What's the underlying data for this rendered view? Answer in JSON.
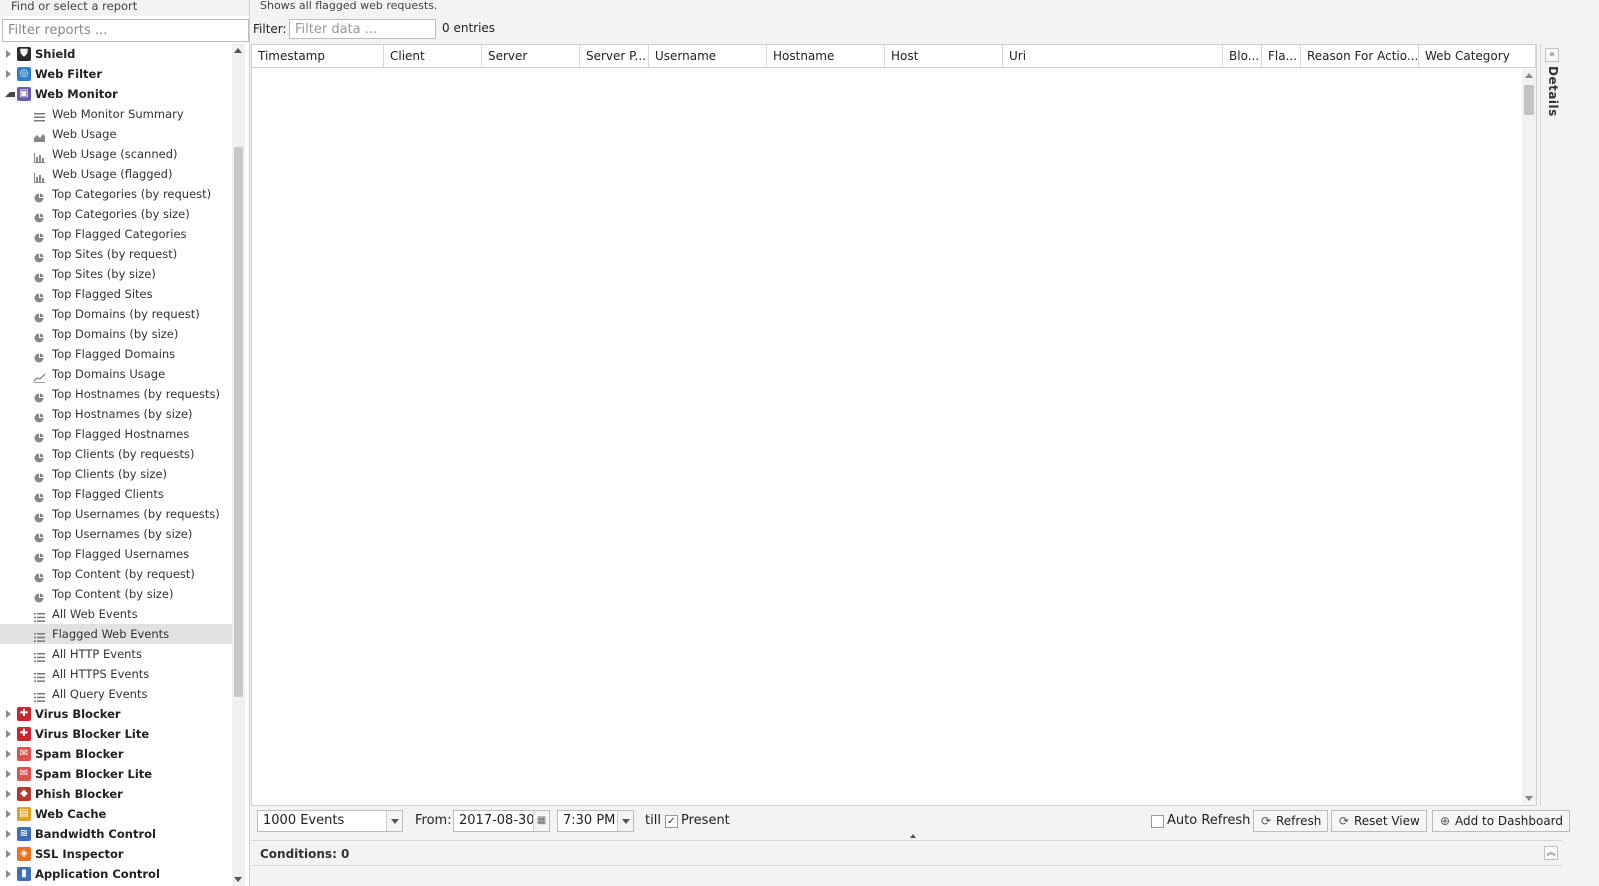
{
  "left": {
    "header": "Find or select a report",
    "filter_placeholder": "Filter reports ...",
    "tree": [
      {
        "label": "Shield",
        "level": "top",
        "expanded": false,
        "icon": "shield-icon",
        "color": "#2b2b2b"
      },
      {
        "label": "Web Filter",
        "level": "top",
        "expanded": false,
        "icon": "web-filter-icon",
        "color": "#2f7fc8"
      },
      {
        "label": "Web Monitor",
        "level": "top",
        "expanded": true,
        "icon": "web-monitor-icon",
        "color": "#6b5bb0"
      },
      {
        "label": "Web Monitor Summary",
        "level": "child",
        "icon": "summary-icon"
      },
      {
        "label": "Web Usage",
        "level": "child",
        "icon": "area-chart-icon"
      },
      {
        "label": "Web Usage (scanned)",
        "level": "child",
        "icon": "bar-chart-icon"
      },
      {
        "label": "Web Usage (flagged)",
        "level": "child",
        "icon": "bar-chart-icon"
      },
      {
        "label": "Top Categories (by request)",
        "level": "child",
        "icon": "pie-chart-icon"
      },
      {
        "label": "Top Categories (by size)",
        "level": "child",
        "icon": "pie-chart-icon"
      },
      {
        "label": "Top Flagged Categories",
        "level": "child",
        "icon": "pie-chart-icon"
      },
      {
        "label": "Top Sites (by request)",
        "level": "child",
        "icon": "pie-chart-icon"
      },
      {
        "label": "Top Sites (by size)",
        "level": "child",
        "icon": "pie-chart-icon"
      },
      {
        "label": "Top Flagged Sites",
        "level": "child",
        "icon": "pie-chart-icon"
      },
      {
        "label": "Top Domains (by request)",
        "level": "child",
        "icon": "pie-chart-icon"
      },
      {
        "label": "Top Domains (by size)",
        "level": "child",
        "icon": "pie-chart-icon"
      },
      {
        "label": "Top Flagged Domains",
        "level": "child",
        "icon": "pie-chart-icon"
      },
      {
        "label": "Top Domains Usage",
        "level": "child",
        "icon": "line-chart-icon"
      },
      {
        "label": "Top Hostnames (by requests)",
        "level": "child",
        "icon": "pie-chart-icon"
      },
      {
        "label": "Top Hostnames (by size)",
        "level": "child",
        "icon": "pie-chart-icon"
      },
      {
        "label": "Top Flagged Hostnames",
        "level": "child",
        "icon": "pie-chart-icon"
      },
      {
        "label": "Top Clients (by requests)",
        "level": "child",
        "icon": "pie-chart-icon"
      },
      {
        "label": "Top Clients (by size)",
        "level": "child",
        "icon": "pie-chart-icon"
      },
      {
        "label": "Top Flagged Clients",
        "level": "child",
        "icon": "pie-chart-icon"
      },
      {
        "label": "Top Usernames (by requests)",
        "level": "child",
        "icon": "pie-chart-icon"
      },
      {
        "label": "Top Usernames (by size)",
        "level": "child",
        "icon": "pie-chart-icon"
      },
      {
        "label": "Top Flagged Usernames",
        "level": "child",
        "icon": "pie-chart-icon"
      },
      {
        "label": "Top Content (by request)",
        "level": "child",
        "icon": "pie-chart-icon"
      },
      {
        "label": "Top Content (by size)",
        "level": "child",
        "icon": "pie-chart-icon"
      },
      {
        "label": "All Web Events",
        "level": "child",
        "icon": "list-icon"
      },
      {
        "label": "Flagged Web Events",
        "level": "child",
        "icon": "list-icon",
        "selected": true
      },
      {
        "label": "All HTTP Events",
        "level": "child",
        "icon": "list-icon"
      },
      {
        "label": "All HTTPS Events",
        "level": "child",
        "icon": "list-icon"
      },
      {
        "label": "All Query Events",
        "level": "child",
        "icon": "list-icon"
      },
      {
        "label": "Virus Blocker",
        "level": "top",
        "expanded": false,
        "icon": "virus-blocker-icon",
        "color": "#c8282d"
      },
      {
        "label": "Virus Blocker Lite",
        "level": "top",
        "expanded": false,
        "icon": "virus-blocker-lite-icon",
        "color": "#c8282d"
      },
      {
        "label": "Spam Blocker",
        "level": "top",
        "expanded": false,
        "icon": "spam-blocker-icon",
        "color": "#d9534f"
      },
      {
        "label": "Spam Blocker Lite",
        "level": "top",
        "expanded": false,
        "icon": "spam-blocker-lite-icon",
        "color": "#d9534f"
      },
      {
        "label": "Phish Blocker",
        "level": "top",
        "expanded": false,
        "icon": "phish-blocker-icon",
        "color": "#b03a2e"
      },
      {
        "label": "Web Cache",
        "level": "top",
        "expanded": false,
        "icon": "web-cache-icon",
        "color": "#e0a020"
      },
      {
        "label": "Bandwidth Control",
        "level": "top",
        "expanded": false,
        "icon": "bandwidth-control-icon",
        "color": "#3b6fb6"
      },
      {
        "label": "SSL Inspector",
        "level": "top",
        "expanded": false,
        "icon": "ssl-inspector-icon",
        "color": "#e8731c"
      },
      {
        "label": "Application Control",
        "level": "top",
        "expanded": false,
        "icon": "application-control-icon",
        "color": "#3b6fb6"
      }
    ]
  },
  "main": {
    "description": "Shows all flagged web requests.",
    "filter_label": "Filter:",
    "filter_placeholder": "Filter data ...",
    "entries": "0 entries",
    "columns": [
      "Timestamp",
      "Client",
      "Server",
      "Server P...",
      "Username",
      "Hostname",
      "Host",
      "Uri",
      "Blo...",
      "Fla...",
      "Reason For Actio...",
      "Web Category"
    ],
    "details_label": "Details"
  },
  "toolbar": {
    "events_select": "1000 Events",
    "from_label": "From:",
    "from_date": "2017-08-30",
    "from_time": "7:30 PM",
    "till_label": "till",
    "present_checked": true,
    "present_label": "Present",
    "auto_refresh_checked": false,
    "auto_refresh_label": "Auto Refresh",
    "refresh_label": "Refresh",
    "reset_view_label": "Reset View",
    "add_dashboard_label": "Add to Dashboard"
  },
  "conditions": {
    "label": "Conditions: 0"
  }
}
